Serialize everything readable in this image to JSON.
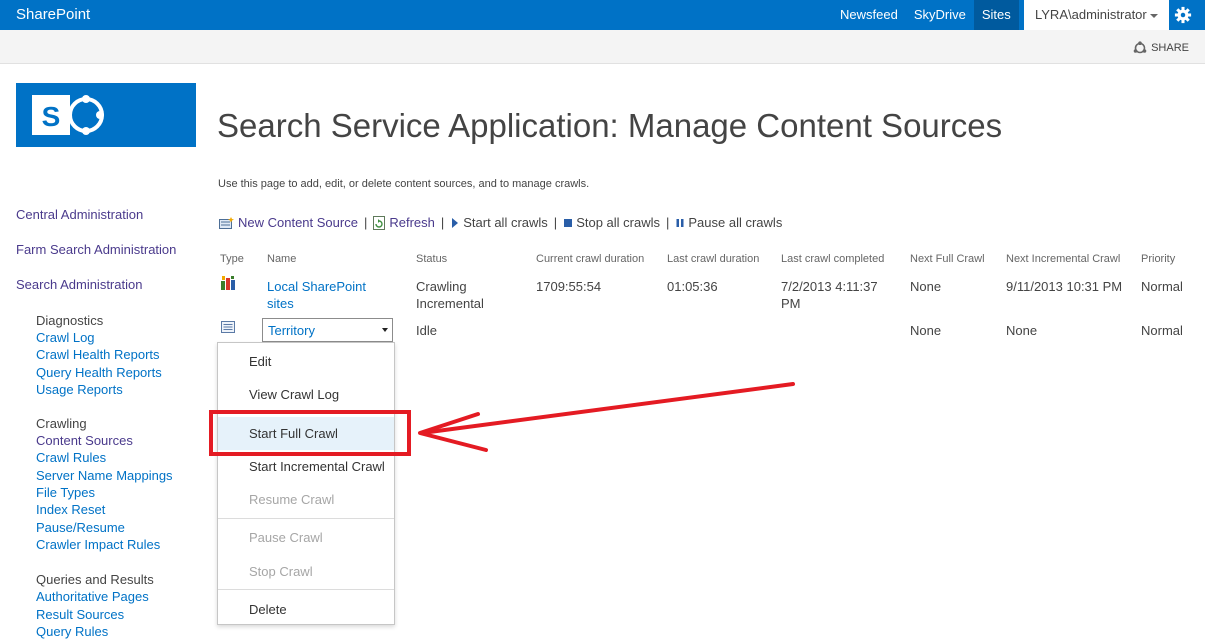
{
  "suitebar": {
    "brand": "SharePoint",
    "nav": [
      "Newsfeed",
      "SkyDrive",
      "Sites"
    ],
    "user": "LYRA\\administrator",
    "share": "SHARE"
  },
  "page": {
    "title": "Search Service Application: Manage Content Sources",
    "description": "Use this page to add, edit, or delete content sources, and to manage crawls."
  },
  "leftnav": {
    "top_links": [
      "Central Administration",
      "Farm Search Administration",
      "Search Administration"
    ],
    "groups": [
      {
        "title": "Diagnostics",
        "links": [
          "Crawl Log",
          "Crawl Health Reports",
          "Query Health Reports",
          "Usage Reports"
        ]
      },
      {
        "title": "Crawling",
        "links": [
          "Content Sources",
          "Crawl Rules",
          "Server Name Mappings",
          "File Types",
          "Index Reset",
          "Pause/Resume",
          "Crawler Impact Rules"
        ]
      },
      {
        "title": "Queries and Results",
        "links": [
          "Authoritative Pages",
          "Result Sources",
          "Query Rules"
        ]
      }
    ]
  },
  "toolbar": {
    "new": "New Content Source",
    "refresh": "Refresh",
    "start_all": "Start all crawls",
    "stop_all": "Stop all crawls",
    "pause_all": "Pause all crawls"
  },
  "table": {
    "headers": [
      "Type",
      "Name",
      "Status",
      "Current crawl duration",
      "Last crawl duration",
      "Last crawl completed",
      "Next Full Crawl",
      "Next Incremental Crawl",
      "Priority"
    ],
    "rows": [
      {
        "name_line1": "Local SharePoint",
        "name_line2": "sites",
        "status_line1": "Crawling",
        "status_line2": "Incremental",
        "current": "1709:55:54",
        "last": "01:05:36",
        "completed_line1": "7/2/2013 4:11:37",
        "completed_line2": "PM",
        "next_full": "None",
        "next_incr": "9/11/2013 10:31 PM",
        "priority": "Normal"
      },
      {
        "name": "Territory",
        "status": "Idle",
        "next_full": "None",
        "next_incr": "None",
        "priority": "Normal"
      }
    ]
  },
  "menu": {
    "items": [
      "Edit",
      "View Crawl Log",
      "Start Full Crawl",
      "Start Incremental Crawl",
      "Resume Crawl",
      "Pause Crawl",
      "Stop Crawl",
      "Delete"
    ]
  },
  "colors": {
    "suitebar": "#0072c6",
    "link": "#0072c6",
    "visited": "#4a3a8c",
    "annotation": "#e41b23"
  }
}
